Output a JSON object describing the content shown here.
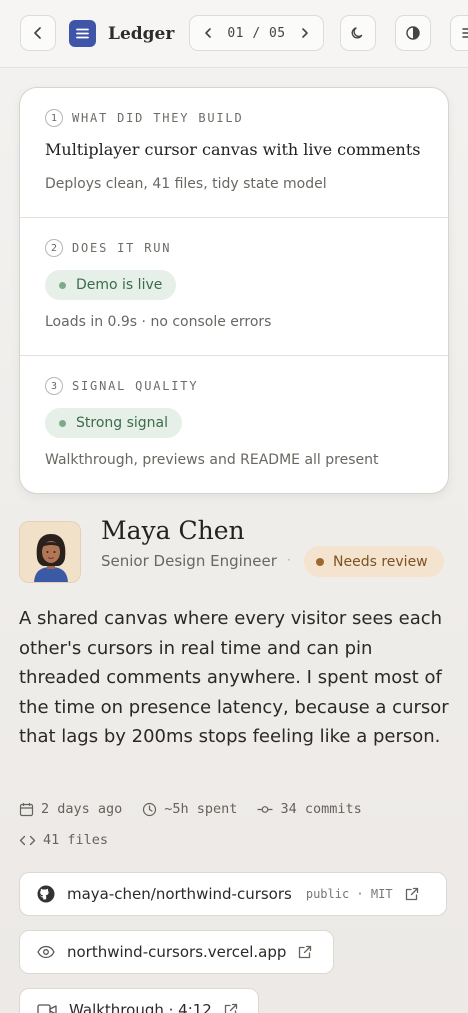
{
  "topbar": {
    "brand": "Ledger",
    "pager": "01 / 05"
  },
  "sections": [
    {
      "num": "1",
      "title": "WHAT DID THEY BUILD",
      "main": "Multiplayer cursor canvas with live comments",
      "sub": "Deploys clean, 41 files, tidy state model"
    },
    {
      "num": "2",
      "title": "DOES IT RUN",
      "pill": "Demo is live",
      "sub": "Loads in 0.9s · no console errors"
    },
    {
      "num": "3",
      "title": "SIGNAL QUALITY",
      "pill": "Strong signal",
      "sub": "Walkthrough, previews and README all present"
    }
  ],
  "profile": {
    "name": "Maya Chen",
    "role": "Senior Design Engineer",
    "separator": "·",
    "status": "Needs review"
  },
  "description": "A shared canvas where every visitor sees each other's cursors in real time and can pin threaded comments anywhere. I spent most of the time on presence latency, because a cursor that lags by 200ms stops feeling like a person.",
  "meta": {
    "date": "2 days ago",
    "time": "~5h spent",
    "commits": "34 commits",
    "files": "41 files"
  },
  "links": {
    "repo": "maya-chen/northwind-cursors",
    "repo_tag": "public · MIT",
    "site": "northwind-cursors.vercel.app",
    "video": "Walkthrough · 4:12"
  },
  "colors": {
    "accent": "#3e55a8",
    "success_bg": "#e6f0e8",
    "success_text": "#3c6b4b",
    "warning_bg": "#f4e3cf",
    "warning_text": "#7a5323"
  }
}
